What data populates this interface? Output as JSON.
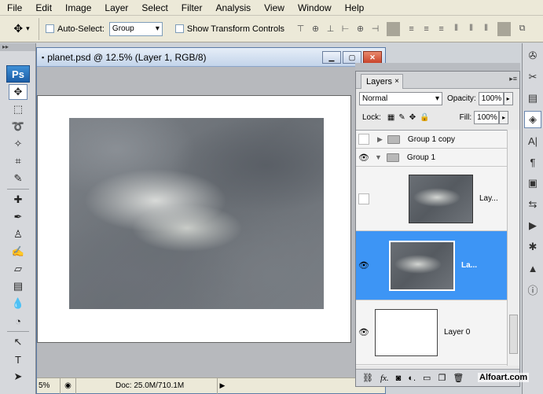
{
  "menu": [
    "File",
    "Edit",
    "Image",
    "Layer",
    "Select",
    "Filter",
    "Analysis",
    "View",
    "Window",
    "Help"
  ],
  "options": {
    "tool_icon": "move-tool",
    "auto_select_label": "Auto-Select:",
    "auto_select_value": "Group",
    "show_transform_label": "Show Transform Controls"
  },
  "document": {
    "title": "planet.psd @ 12.5% (Layer 1, RGB/8)",
    "status_zoom": "5%",
    "status_doc": "Doc: 25.0M/710.1M"
  },
  "toolbox": {
    "logo": "Ps"
  },
  "layers_panel": {
    "tab_label": "Layers",
    "tab_close": "×",
    "blend_mode": "Normal",
    "opacity_label": "Opacity:",
    "opacity_value": "100%",
    "lock_label": "Lock:",
    "fill_label": "Fill:",
    "fill_value": "100%",
    "layers": [
      {
        "name": "Group 1 copy",
        "visible": false,
        "type": "group",
        "expanded": false
      },
      {
        "name": "Group 1",
        "visible": true,
        "type": "group",
        "expanded": true
      },
      {
        "name": "Lay...",
        "visible": false,
        "type": "layer"
      },
      {
        "name": "La...",
        "visible": true,
        "type": "layer",
        "selected": true
      },
      {
        "name": "Layer 0",
        "visible": true,
        "type": "layer"
      }
    ],
    "bottom_icons": [
      "link-icon",
      "fx-icon",
      "mask-icon",
      "adjustment-icon",
      "folder-icon",
      "new-layer-icon",
      "trash-icon"
    ]
  },
  "watermark": "Alfoart.com"
}
